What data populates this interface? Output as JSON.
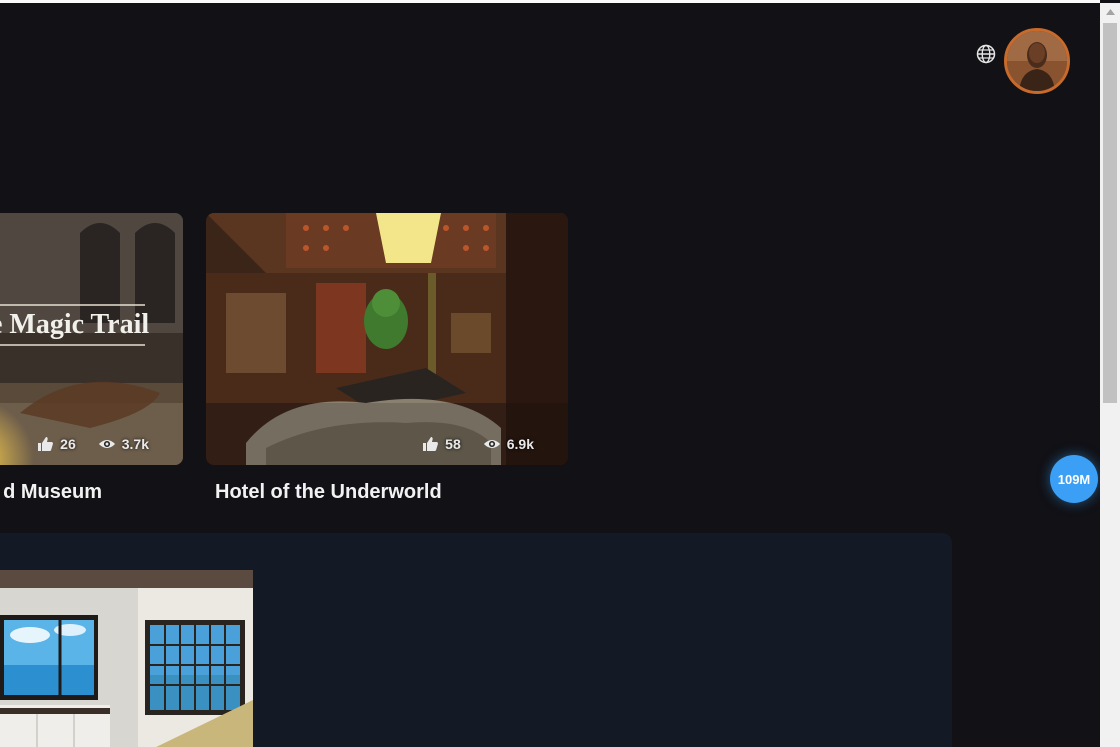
{
  "header": {
    "language_icon": "globe-icon",
    "avatar_alt": "user-avatar"
  },
  "cards": [
    {
      "title": "d Museum",
      "banner_text": "e Magic Trail",
      "likes": "26",
      "views": "3.7k"
    },
    {
      "title": "Hotel of the Underworld",
      "likes": "58",
      "views": "6.9k"
    }
  ],
  "fab": {
    "label": "109M"
  },
  "colors": {
    "background": "#111116",
    "panel": "#131a26",
    "accent": "#3a9ff5",
    "avatar_border": "#c76a2b"
  }
}
